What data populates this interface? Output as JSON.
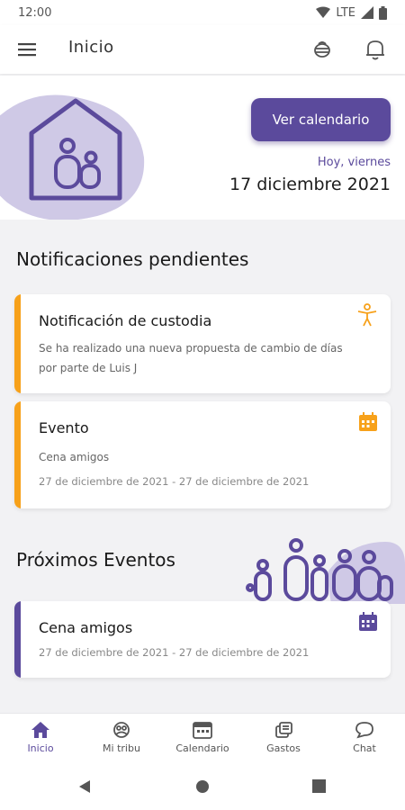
{
  "status_bar": {
    "time": "12:00",
    "network": "LTE"
  },
  "app_bar": {
    "title": "Inicio"
  },
  "hero": {
    "button_label": "Ver calendario",
    "today_label": "Hoy, viernes",
    "date": "17 diciembre 2021"
  },
  "pending": {
    "section_title": "Notificaciones pendientes",
    "cards": [
      {
        "title": "Notificación de custodia",
        "text": "Se ha realizado una nueva propuesta de cambio de días por parte de Luis J",
        "accent": "#f7a11a",
        "icon": "custody-person-icon"
      },
      {
        "title": "Evento",
        "text": "Cena amigos",
        "dates": "27 de diciembre de 2021 - 27 de diciembre de 2021",
        "accent": "#f7a11a",
        "icon": "calendar-icon"
      }
    ]
  },
  "upcoming": {
    "section_title": "Próximos Eventos",
    "cards": [
      {
        "title": "Cena amigos",
        "dates": "27 de diciembre de 2021 - 27 de diciembre de 2021",
        "accent": "#5b4a9c",
        "icon": "calendar-icon"
      }
    ]
  },
  "bottom_nav": [
    {
      "label": "Inicio",
      "icon": "home-icon",
      "active": true
    },
    {
      "label": "Mi tribu",
      "icon": "tribe-icon",
      "active": false
    },
    {
      "label": "Calendario",
      "icon": "calendar-icon",
      "active": false
    },
    {
      "label": "Gastos",
      "icon": "expenses-icon",
      "active": false
    },
    {
      "label": "Chat",
      "icon": "chat-icon",
      "active": false
    }
  ],
  "colors": {
    "primary": "#5b4a9c",
    "accent_orange": "#f7a11a",
    "light_purple": "#b8b0d8"
  }
}
